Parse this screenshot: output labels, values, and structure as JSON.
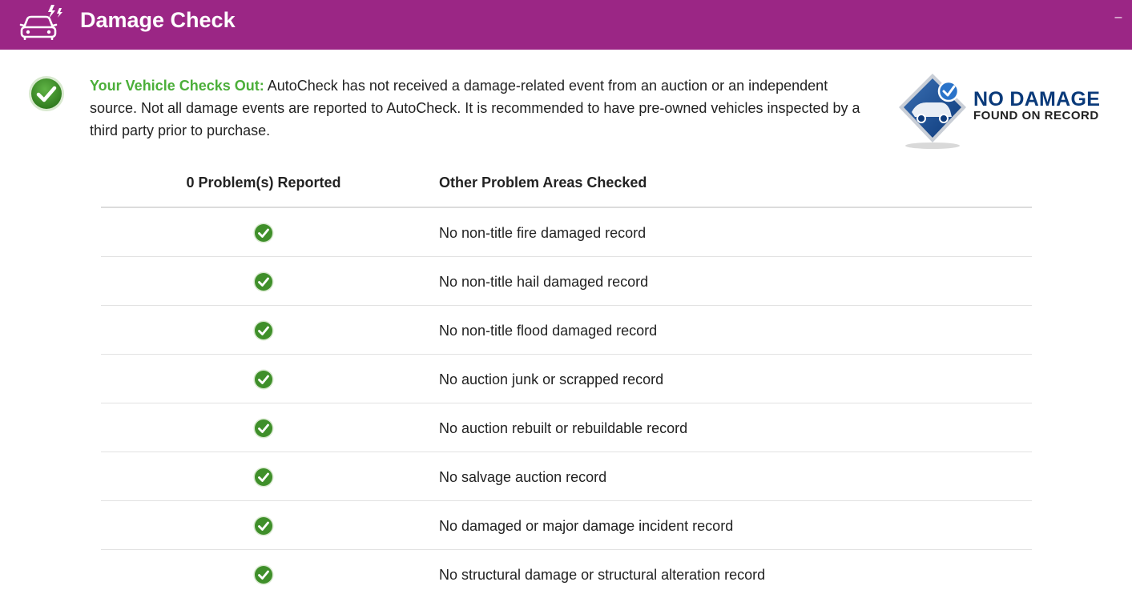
{
  "header": {
    "title": "Damage Check",
    "icon": "damaged-car-icon",
    "collapse_label": "–",
    "background": "#9b2685"
  },
  "summary": {
    "icon": "check-circle-icon",
    "lead": "Your Vehicle Checks Out:",
    "body": " AutoCheck has not received a damage-related event from an auction or an independent source. Not all damage events are reported to AutoCheck. It is recommended to have pre-owned vehicles inspected by a third party prior to purchase.",
    "lead_color": "#4caf3a"
  },
  "badge": {
    "icon": "no-damage-shield-icon",
    "line1": "NO DAMAGE",
    "line2": "FOUND ON RECORD"
  },
  "table": {
    "headers": {
      "left": "0 Problem(s) Reported",
      "right": "Other Problem Areas Checked"
    },
    "rows": [
      {
        "status_icon": "check-circle-icon",
        "text": "No non-title fire damaged record"
      },
      {
        "status_icon": "check-circle-icon",
        "text": "No non-title hail damaged record"
      },
      {
        "status_icon": "check-circle-icon",
        "text": "No non-title flood damaged record"
      },
      {
        "status_icon": "check-circle-icon",
        "text": "No auction junk or scrapped record"
      },
      {
        "status_icon": "check-circle-icon",
        "text": "No auction rebuilt or rebuildable record"
      },
      {
        "status_icon": "check-circle-icon",
        "text": "No salvage auction record"
      },
      {
        "status_icon": "check-circle-icon",
        "text": "No damaged or major damage incident record"
      },
      {
        "status_icon": "check-circle-icon",
        "text": "No structural damage or structural alteration record"
      }
    ]
  },
  "colors": {
    "check_green": "#4a9a2f",
    "badge_blue": "#0a3a7a"
  }
}
